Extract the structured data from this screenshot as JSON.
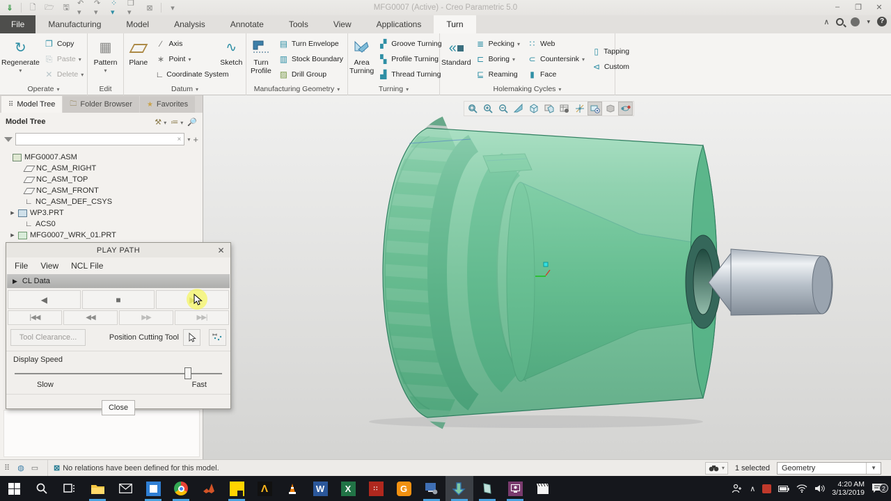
{
  "window": {
    "title": "MFG0007 (Active) - Creo Parametric 5.0"
  },
  "quick_access": {
    "icons": [
      "creo-home",
      "new-file",
      "open-file",
      "save",
      "undo",
      "redo",
      "model-display",
      "window-switch",
      "close-window",
      "customize"
    ]
  },
  "ribbon": {
    "tabs": [
      "File",
      "Manufacturing",
      "Model",
      "Analysis",
      "Annotate",
      "Tools",
      "View",
      "Applications",
      "Turn"
    ],
    "active_tab": "Turn",
    "groups": [
      {
        "label": "Operate",
        "buttons": [
          {
            "label": "Regenerate"
          },
          {
            "label": "Copy"
          },
          {
            "label": "Paste"
          },
          {
            "label": "Delete"
          }
        ]
      },
      {
        "label": "Edit",
        "buttons": [
          {
            "label": "Pattern"
          }
        ]
      },
      {
        "label": "Datum",
        "buttons": [
          {
            "label": "Plane"
          },
          {
            "label": "Axis"
          },
          {
            "label": "Point"
          },
          {
            "label": "Coordinate System"
          },
          {
            "label": "Sketch"
          }
        ]
      },
      {
        "label": "Manufacturing Geometry",
        "buttons": [
          {
            "label": "Turn Profile"
          },
          {
            "label": "Turn Envelope"
          },
          {
            "label": "Stock Boundary"
          },
          {
            "label": "Drill Group"
          }
        ]
      },
      {
        "label": "Turning",
        "buttons": [
          {
            "label": "Area Turning"
          },
          {
            "label": "Groove Turning"
          },
          {
            "label": "Profile Turning"
          },
          {
            "label": "Thread Turning"
          }
        ]
      },
      {
        "label": "Holemaking Cycles",
        "buttons": [
          {
            "label": "Standard"
          },
          {
            "label": "Pecking"
          },
          {
            "label": "Boring"
          },
          {
            "label": "Reaming"
          },
          {
            "label": "Web"
          },
          {
            "label": "Countersink"
          },
          {
            "label": "Face"
          },
          {
            "label": "Tapping"
          },
          {
            "label": "Custom"
          }
        ]
      }
    ]
  },
  "navigator": {
    "tabs": [
      "Model Tree",
      "Folder Browser",
      "Favorites"
    ],
    "header_title": "Model Tree",
    "filter_value": "",
    "tree": [
      {
        "label": "MFG0007.ASM",
        "icon": "assembly"
      },
      {
        "label": "NC_ASM_RIGHT",
        "icon": "datum-plane"
      },
      {
        "label": "NC_ASM_TOP",
        "icon": "datum-plane"
      },
      {
        "label": "NC_ASM_FRONT",
        "icon": "datum-plane"
      },
      {
        "label": "NC_ASM_DEF_CSYS",
        "icon": "csys"
      },
      {
        "label": "WP3.PRT",
        "icon": "part"
      },
      {
        "label": "ACS0",
        "icon": "csys"
      },
      {
        "label": "MFG0007_WRK_01.PRT",
        "icon": "part-green"
      }
    ]
  },
  "dialog": {
    "title": "PLAY PATH",
    "menus": [
      "File",
      "View",
      "NCL File"
    ],
    "section_label": "CL Data",
    "buttons": {
      "tool_clearance": "Tool Clearance...",
      "close": "Close"
    },
    "labels": {
      "position_cutting_tool": "Position Cutting Tool",
      "display_speed": "Display Speed",
      "slow": "Slow",
      "fast": "Fast"
    },
    "slider_percent": 82
  },
  "graphics_toolbar": {
    "icons": [
      "refit",
      "zoom-in",
      "zoom-out",
      "repaint",
      "display-style",
      "saved-orientations",
      "view-manager",
      "datum-display",
      "annotation-display",
      "show-model",
      "spin-center"
    ]
  },
  "status_bar": {
    "message": "No relations have been defined for this model.",
    "selection": "1 selected",
    "selection_filter": "Geometry"
  },
  "taskbar": {
    "icons": [
      "start",
      "search",
      "task-view",
      "file-explorer",
      "mail",
      "photos",
      "chrome",
      "matlab",
      "notes",
      "ansys",
      "vlc",
      "word",
      "excel",
      "reference-manager",
      "download-manager",
      "remote-desktop",
      "creo-parametric",
      "creo-view",
      "screen-recorder",
      "movie-maker"
    ],
    "time": "4:20 AM",
    "date": "3/13/2019",
    "notification_badge": "2"
  },
  "colors": {
    "accent_teal": "#2f8fa5",
    "stock_green": "#5fb98c",
    "tool_gray": "#aeb7c0",
    "taskbar": "#15171c",
    "highlight_yellow": "#f6f650"
  }
}
